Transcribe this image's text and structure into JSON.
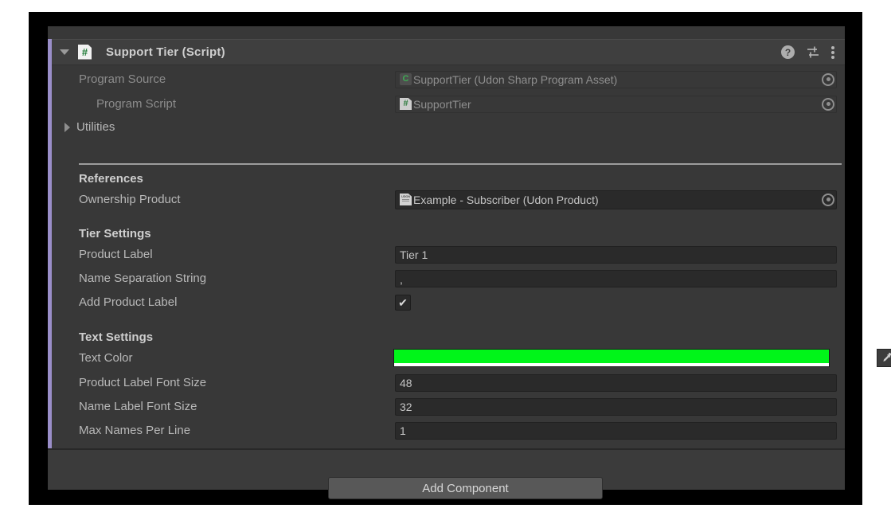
{
  "component": {
    "title": "Support Tier (Script)",
    "icon": "script-hash-icon",
    "foldout_expanded": true,
    "accent_color": "#9a8ec9",
    "header_icons": [
      {
        "name": "help-icon",
        "glyph": "?"
      },
      {
        "name": "preset-icon",
        "glyph": ""
      },
      {
        "name": "kebab-menu-icon",
        "glyph": ""
      }
    ]
  },
  "udon": {
    "program_source_label": "Program Source",
    "program_source_value": "SupportTier (Udon Sharp Program Asset)",
    "program_source_icon": "udon-sharp-asset-icon",
    "program_script_label": "Program Script",
    "program_script_value": "SupportTier",
    "program_script_icon": "script-hash-icon",
    "utilities_label": "Utilities",
    "utilities_expanded": false
  },
  "sections": {
    "references": {
      "header": "References",
      "ownership_product_label": "Ownership Product",
      "ownership_product_value": "Example - Subscriber (Udon Product)",
      "ownership_product_icon": "udon-product-asset-icon"
    },
    "tier_settings": {
      "header": "Tier Settings",
      "product_label_label": "Product Label",
      "product_label_value": "Tier 1",
      "name_separation_label": "Name Separation String",
      "name_separation_value": ",",
      "add_product_label_label": "Add Product Label",
      "add_product_label_checked": "✔"
    },
    "text_settings": {
      "header": "Text Settings",
      "text_color_label": "Text Color",
      "text_color_value": "#00F519",
      "text_color_alpha": "#ffffff",
      "product_label_font_size_label": "Product Label Font Size",
      "product_label_font_size_value": "48",
      "name_label_font_size_label": "Name Label Font Size",
      "name_label_font_size_value": "32",
      "max_names_per_line_label": "Max Names Per Line",
      "max_names_per_line_value": "1"
    }
  },
  "footer": {
    "add_component_label": "Add Component"
  }
}
